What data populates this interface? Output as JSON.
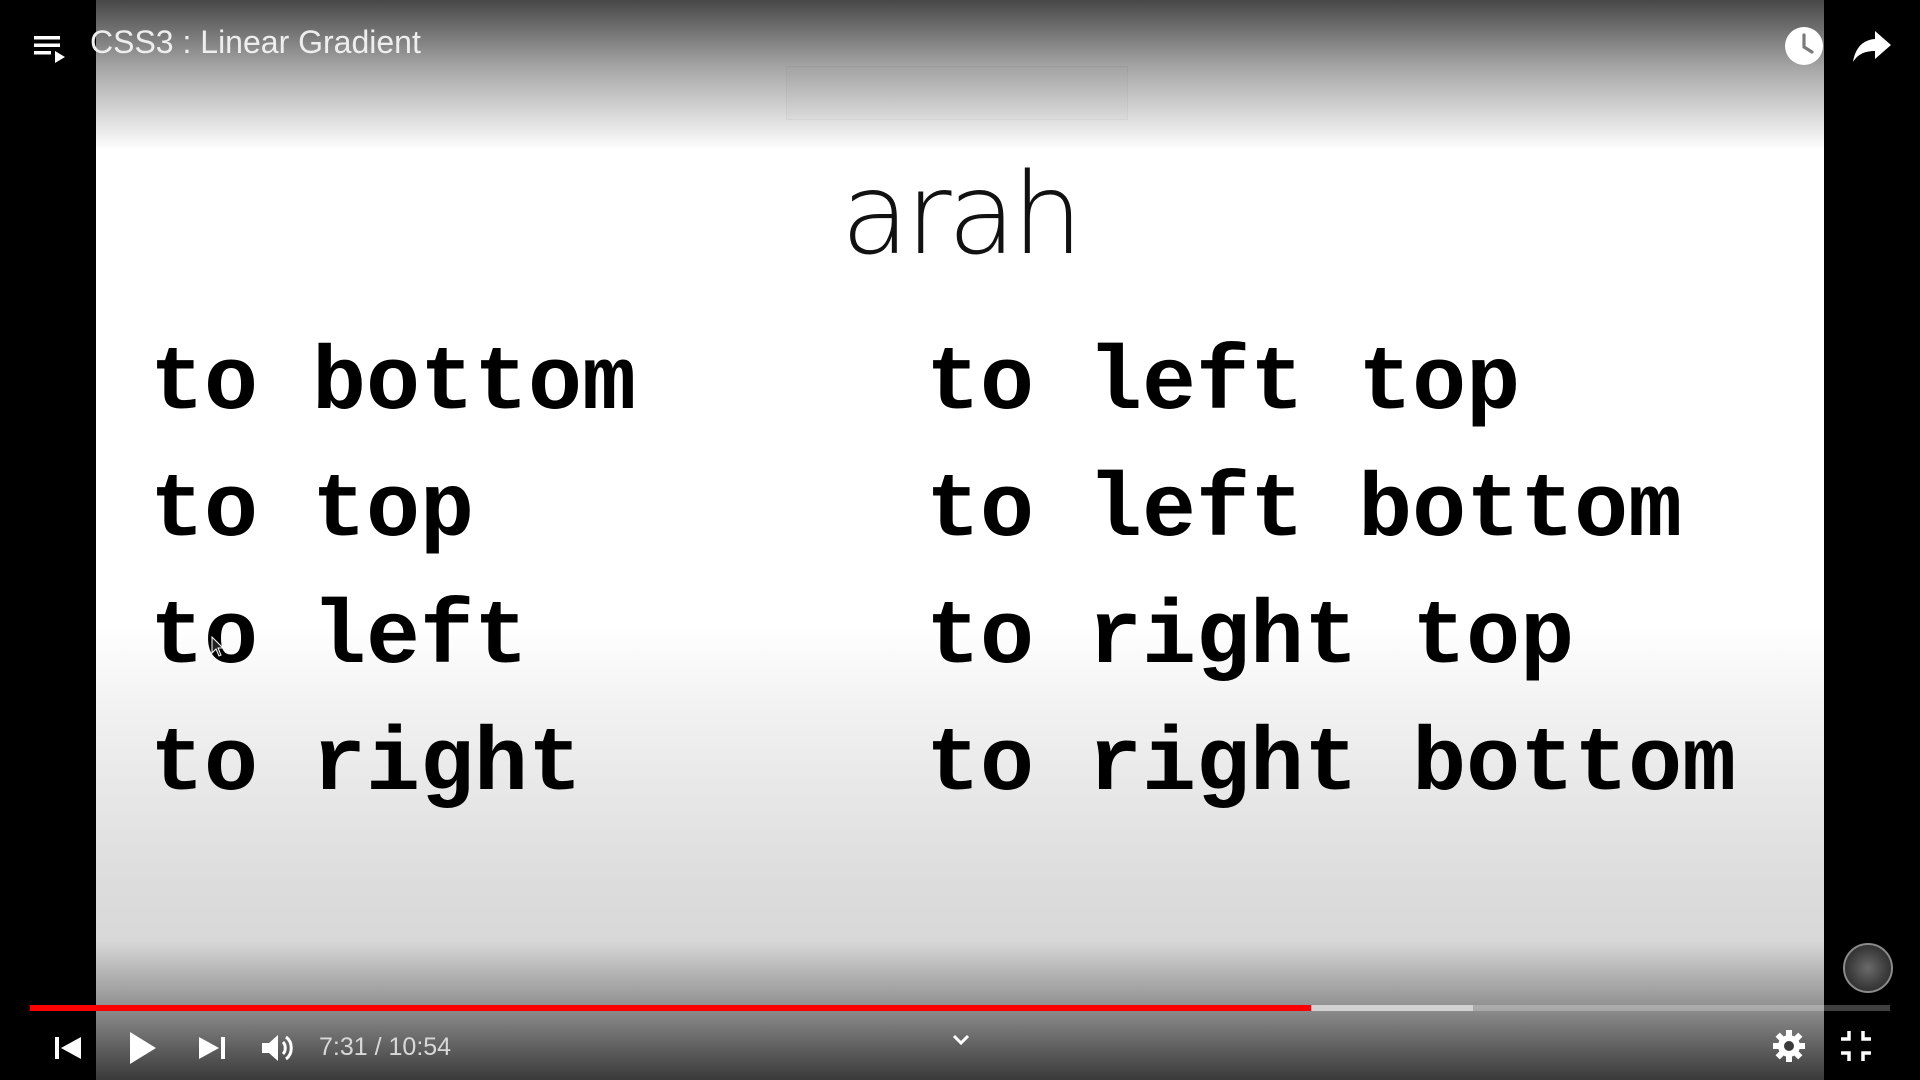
{
  "video": {
    "title": "CSS3 : Linear Gradient"
  },
  "slide": {
    "title": "arah",
    "left_column": [
      "to bottom",
      "to top",
      "to left",
      "to right"
    ],
    "right_column": [
      "to left top",
      "to left bottom",
      "to right top",
      "to right bottom"
    ]
  },
  "controls": {
    "current_time": "7:31",
    "separator": " / ",
    "duration": "10:54",
    "played_fraction": 0.6886,
    "buffered_fraction": 0.7758
  },
  "icons": {
    "playlist": "playlist-icon",
    "watch_later": "clock-icon",
    "share": "share-arrow-icon",
    "previous": "skip-previous-icon",
    "play": "play-icon",
    "next": "skip-next-icon",
    "volume": "volume-icon",
    "chevron": "chevron-down-icon",
    "settings": "gear-icon",
    "exit_fullscreen": "exit-fullscreen-icon",
    "watermark": "channel-watermark-icon"
  },
  "colors": {
    "progress_played": "#ff0000",
    "title_text": "#eeeeee",
    "slide_text": "#000000"
  }
}
